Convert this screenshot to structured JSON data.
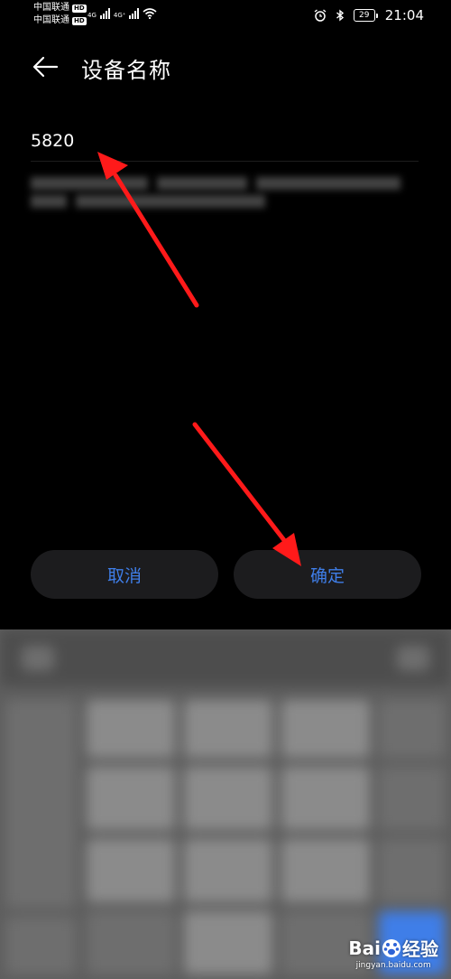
{
  "status_bar": {
    "carrier_1": "中国联通",
    "carrier_2": "中国联通",
    "hd_badge": "HD",
    "net_1": "4G",
    "net_2": "4G⁺",
    "battery_level": "29",
    "time": "21:04",
    "icons": [
      "signal-icon",
      "wifi-icon",
      "alarm-icon",
      "bluetooth-icon",
      "battery-icon"
    ]
  },
  "header": {
    "title": "设备名称",
    "back_icon": "arrow-left-icon"
  },
  "device_name_input": {
    "value": "5820"
  },
  "dialog": {
    "cancel_label": "取消",
    "confirm_label": "确定"
  },
  "watermark": {
    "logo_left": "Bai",
    "logo_right": "经验",
    "url": "jingyan.baidu.com"
  },
  "colors": {
    "background": "#000000",
    "button_bg": "#1c1c1e",
    "accent": "#3f7ee8",
    "annotation_arrow": "#ff1a1a"
  }
}
